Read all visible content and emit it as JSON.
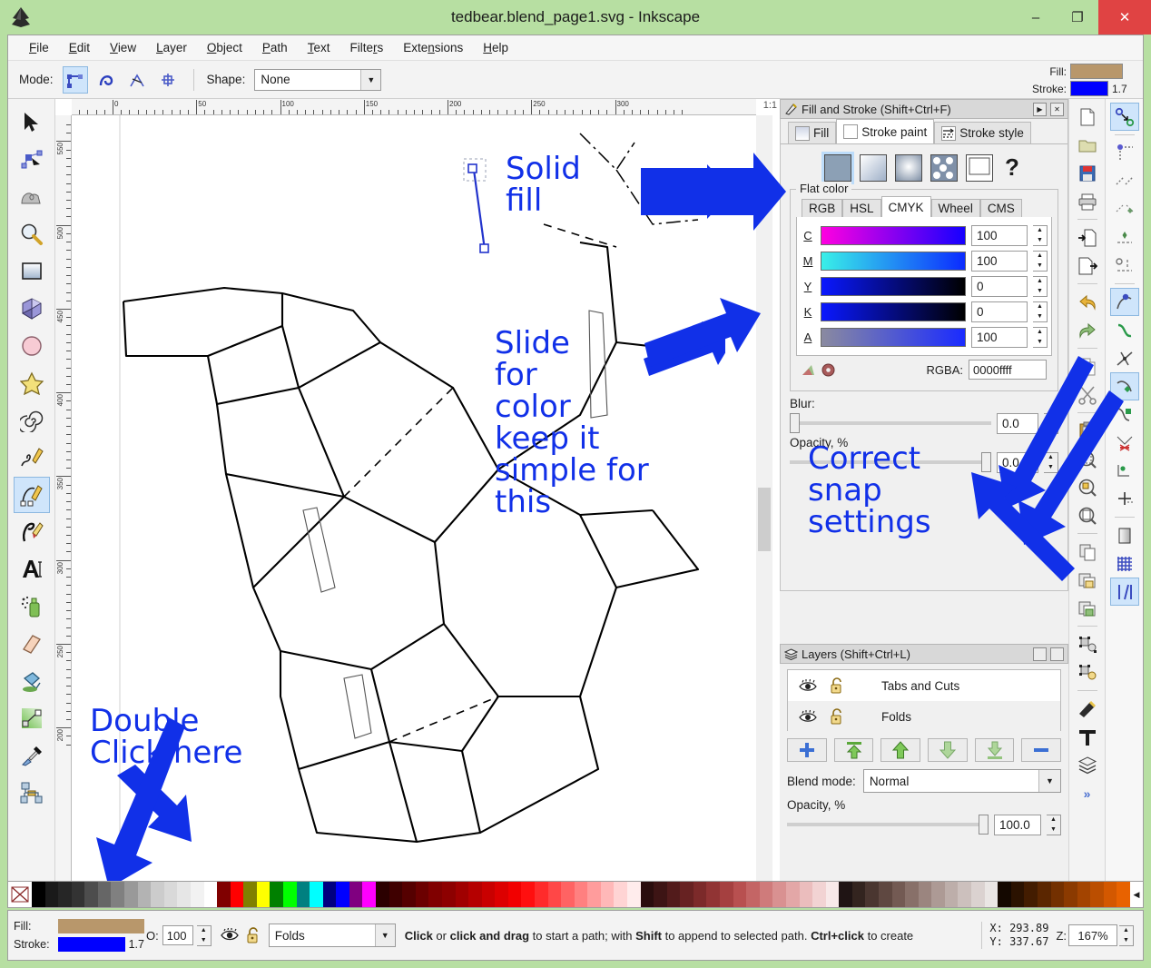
{
  "window": {
    "title": "tedbear.blend_page1.svg - Inkscape",
    "logo_icon": "inkscape-logo-icon",
    "minimize_label": "–",
    "maximize_label": "❐",
    "close_label": "✕"
  },
  "menubar": [
    {
      "label": "File",
      "accel": "F"
    },
    {
      "label": "Edit",
      "accel": "E"
    },
    {
      "label": "View",
      "accel": "V"
    },
    {
      "label": "Layer",
      "accel": "L"
    },
    {
      "label": "Object",
      "accel": "O"
    },
    {
      "label": "Path",
      "accel": "P"
    },
    {
      "label": "Text",
      "accel": "T"
    },
    {
      "label": "Filters",
      "accel": "r"
    },
    {
      "label": "Extensions",
      "accel": "n"
    },
    {
      "label": "Help",
      "accel": "H"
    }
  ],
  "toolopts": {
    "mode_label": "Mode:",
    "mode_buttons": [
      "bezier-mode-icon",
      "spiro-mode-icon",
      "bspline-mode-icon",
      "paraxial-mode-icon"
    ],
    "shape_label": "Shape:",
    "shape_value": "None"
  },
  "fill_stroke_indicator": {
    "fill_label": "Fill:",
    "stroke_label": "Stroke:",
    "fill_color": "#b8976b",
    "stroke_color": "#0000ff",
    "stroke_width": "1.7"
  },
  "toolbox": [
    {
      "name": "selector-tool",
      "icon": "arrow-cursor-icon",
      "selected": false
    },
    {
      "name": "node-tool",
      "icon": "node-editor-icon",
      "selected": false
    },
    {
      "name": "tweak-tool",
      "icon": "tweak-icon",
      "selected": false
    },
    {
      "name": "zoom-tool",
      "icon": "magnifier-icon",
      "selected": false
    },
    {
      "name": "rectangle-tool",
      "icon": "rectangle-icon",
      "selected": false
    },
    {
      "name": "box3d-tool",
      "icon": "cube-3d-icon",
      "selected": false
    },
    {
      "name": "ellipse-tool",
      "icon": "ellipse-icon",
      "selected": false
    },
    {
      "name": "star-tool",
      "icon": "star-icon",
      "selected": false
    },
    {
      "name": "spiral-tool",
      "icon": "spiral-icon",
      "selected": false
    },
    {
      "name": "pencil-tool",
      "icon": "pencil-freehand-icon",
      "selected": false
    },
    {
      "name": "bezier-tool",
      "icon": "bezier-pen-icon",
      "selected": true
    },
    {
      "name": "calligraphy-tool",
      "icon": "calligraphy-pen-icon",
      "selected": false
    },
    {
      "name": "text-tool",
      "icon": "text-A-icon",
      "selected": false
    },
    {
      "name": "spray-tool",
      "icon": "spray-can-icon",
      "selected": false
    },
    {
      "name": "eraser-tool",
      "icon": "eraser-icon",
      "selected": false
    },
    {
      "name": "bucket-tool",
      "icon": "paint-bucket-icon",
      "selected": false
    },
    {
      "name": "gradient-tool",
      "icon": "gradient-icon",
      "selected": false
    },
    {
      "name": "dropper-tool",
      "icon": "eyedropper-icon",
      "selected": false
    },
    {
      "name": "connector-tool",
      "icon": "connector-icon",
      "selected": false
    }
  ],
  "rulers": {
    "horizontal_labels": [
      "0",
      "50",
      "100",
      "150",
      "200",
      "250",
      "300"
    ],
    "vertical_labels": [
      "550",
      "500",
      "450",
      "400",
      "350",
      "300",
      "250",
      "200"
    ],
    "unit_badge": "1:1"
  },
  "canvas_notes": [
    {
      "id": "note-solid-fill",
      "text": "Solid\nfill"
    },
    {
      "id": "note-slide-for-color",
      "text": "Slide\nfor\ncolor\nkeep it\nsimple for\nthis"
    },
    {
      "id": "note-correct-snap",
      "text": "Correct\nsnap\nsettings"
    },
    {
      "id": "note-double-click",
      "text": "Double\nClick here"
    }
  ],
  "annotation_color": "#1130e8",
  "fill_stroke_dialog": {
    "title": "Fill and Stroke (Shift+Ctrl+F)",
    "icon": "fill-stroke-icon",
    "collapse_label": "▶",
    "close_label": "✕",
    "tabs": [
      {
        "label": "Fill",
        "icon": "fill-swatch-icon",
        "active": false
      },
      {
        "label": "Stroke paint",
        "icon": "stroke-swatch-icon",
        "active": true
      },
      {
        "label": "Stroke style",
        "icon": "stroke-style-icon",
        "active": false
      }
    ],
    "paint_buttons": [
      {
        "name": "flat-color-button",
        "icon": "flat-color-icon",
        "selected": true
      },
      {
        "name": "linear-gradient-button",
        "icon": "linear-gradient-icon",
        "selected": false
      },
      {
        "name": "radial-gradient-button",
        "icon": "radial-gradient-icon",
        "selected": false
      },
      {
        "name": "pattern-button",
        "icon": "pattern-icon",
        "selected": false
      },
      {
        "name": "swatch-button",
        "icon": "swatch-icon",
        "selected": false
      },
      {
        "name": "unknown-paint-button",
        "icon": "question-mark-icon",
        "selected": false
      }
    ],
    "group_label": "Flat color",
    "color_tabs": [
      {
        "label": "RGB",
        "active": false
      },
      {
        "label": "HSL",
        "active": false
      },
      {
        "label": "CMYK",
        "active": true
      },
      {
        "label": "Wheel",
        "active": false
      },
      {
        "label": "CMS",
        "active": false
      }
    ],
    "cmyk": [
      {
        "key": "C",
        "value": "100",
        "from": "#ff00e0",
        "to": "#1500ff"
      },
      {
        "key": "M",
        "value": "100",
        "from": "#39f0e8",
        "to": "#0b2bff"
      },
      {
        "key": "Y",
        "value": "0",
        "from": "#0a18ff",
        "to": "#000000"
      },
      {
        "key": "K",
        "value": "0",
        "from": "#0a18ff",
        "to": "#000000"
      },
      {
        "key": "A",
        "value": "100",
        "from": "#8a8aa0",
        "to": "#1a2bff"
      }
    ],
    "rgba_label": "RGBA:",
    "rgba_value": "0000ffff",
    "bottom_icons": [
      "color-managed-icon",
      "out-of-gamut-icon"
    ],
    "blur_label": "Blur:",
    "blur_value": "0.0",
    "opacity_label": "Opacity, %",
    "opacity_value": "0.0"
  },
  "layers_dialog": {
    "title": "Layers (Shift+Ctrl+L)",
    "icon": "layers-icon",
    "rows": [
      {
        "name": "Tabs and Cuts",
        "visible_icon": "eye-icon",
        "lock_icon": "unlock-icon"
      },
      {
        "name": "Folds",
        "visible_icon": "eye-icon",
        "lock_icon": "unlock-icon"
      }
    ],
    "buttons": [
      {
        "name": "add-layer-button",
        "icon": "plus-icon"
      },
      {
        "name": "raise-to-top-button",
        "icon": "arrow-to-top-icon"
      },
      {
        "name": "raise-layer-button",
        "icon": "arrow-up-icon"
      },
      {
        "name": "lower-layer-button",
        "icon": "arrow-down-icon"
      },
      {
        "name": "lower-to-bottom-button",
        "icon": "arrow-to-bottom-icon"
      },
      {
        "name": "delete-layer-button",
        "icon": "minus-icon"
      }
    ],
    "blend_label": "Blend mode:",
    "blend_value": "Normal",
    "opacity_label": "Opacity, %",
    "opacity_value": "100.0"
  },
  "command_bar": [
    {
      "name": "new-document-button",
      "icon": "new-document-icon"
    },
    {
      "name": "open-document-button",
      "icon": "folder-open-icon"
    },
    {
      "name": "save-document-button",
      "icon": "floppy-save-icon"
    },
    {
      "name": "print-button",
      "icon": "printer-icon"
    },
    {
      "name": "import-button",
      "icon": "import-icon"
    },
    {
      "name": "export-button",
      "icon": "export-icon"
    },
    {
      "name": "undo-button",
      "icon": "undo-arrow-icon"
    },
    {
      "name": "redo-button",
      "icon": "redo-arrow-icon"
    },
    {
      "name": "copy-button",
      "icon": "copy-icon"
    },
    {
      "name": "cut-button",
      "icon": "scissors-icon"
    },
    {
      "name": "paste-button",
      "icon": "clipboard-paste-icon"
    },
    {
      "name": "zoom-selection-button",
      "icon": "zoom-selection-icon"
    },
    {
      "name": "zoom-drawing-button",
      "icon": "zoom-drawing-icon"
    },
    {
      "name": "zoom-page-button",
      "icon": "zoom-page-icon"
    },
    {
      "name": "duplicate-button",
      "icon": "duplicate-icon"
    },
    {
      "name": "group-button",
      "icon": "group-lock-icon"
    },
    {
      "name": "ungroup-button",
      "icon": "ungroup-icon"
    },
    {
      "name": "object-to-path-button",
      "icon": "object-to-path-icon"
    },
    {
      "name": "stroke-to-path-button",
      "icon": "stroke-to-path-icon"
    },
    {
      "name": "xml-editor-button",
      "icon": "xml-editor-icon"
    },
    {
      "name": "text-and-font-button",
      "icon": "text-font-icon"
    },
    {
      "name": "layers-button",
      "icon": "layers-stack-icon"
    },
    {
      "name": "overflow-button",
      "icon": "chevron-double-right-icon"
    }
  ],
  "snap_bar": [
    {
      "name": "enable-snapping-toggle",
      "icon": "snap-master-icon",
      "on": true
    },
    {
      "name": "snap-bounding-box-toggle",
      "icon": "snap-bbox-icon",
      "on": false
    },
    {
      "name": "snap-bbox-edge-toggle",
      "icon": "snap-bbox-edge-icon",
      "on": false
    },
    {
      "name": "snap-bbox-corner-toggle",
      "icon": "snap-bbox-corner-icon",
      "on": false
    },
    {
      "name": "snap-bbox-edge-midpoint-toggle",
      "icon": "snap-edge-mid-icon",
      "on": false
    },
    {
      "name": "snap-bbox-center-toggle",
      "icon": "snap-bbox-center-icon",
      "on": false
    },
    {
      "name": "snap-nodes-paths-toggle",
      "icon": "snap-node-icon",
      "on": true
    },
    {
      "name": "snap-path-toggle",
      "icon": "snap-path-icon",
      "on": false
    },
    {
      "name": "snap-path-intersection-toggle",
      "icon": "snap-path-intersection-icon",
      "on": false
    },
    {
      "name": "snap-cusp-node-toggle",
      "icon": "snap-cusp-icon",
      "on": true
    },
    {
      "name": "snap-smooth-node-toggle",
      "icon": "snap-smooth-icon",
      "on": false
    },
    {
      "name": "snap-midpoint-toggle",
      "icon": "snap-midpoint-icon",
      "on": false
    },
    {
      "name": "snap-object-center-toggle",
      "icon": "snap-object-center-icon",
      "on": false
    },
    {
      "name": "snap-rotation-center-toggle",
      "icon": "snap-rotation-center-icon",
      "on": false
    },
    {
      "name": "snap-page-border-toggle",
      "icon": "snap-page-border-icon",
      "on": false
    },
    {
      "name": "snap-grid-toggle",
      "icon": "snap-grid-icon",
      "on": false
    },
    {
      "name": "snap-guide-toggle",
      "icon": "snap-guide-icon",
      "on": true
    }
  ],
  "palette": {
    "none_icon": "no-color-x-icon",
    "left_arrow": "◀",
    "right_arrow": "▶",
    "colors": [
      "#000000",
      "#1a1a1a",
      "#262626",
      "#333333",
      "#4d4d4d",
      "#666666",
      "#808080",
      "#999999",
      "#b3b3b3",
      "#ccccc c",
      "#d9d9d9",
      "#e6e6e6",
      "#f2f2f2",
      "#ffffff",
      "#800000",
      "#ff0000",
      "#808000",
      "#ffff00",
      "#008000",
      "#00ff00",
      "#008080",
      "#00ffff",
      "#000080",
      "#0000ff",
      "#800080",
      "#ff00ff",
      "#2b0000",
      "#3f0000",
      "#550000",
      "#6b0000",
      "#800000",
      "#8d0000",
      "#a00000",
      "#b50000",
      "#c90000",
      "#dd0000",
      "#f20000",
      "#ff0f0f",
      "#ff2b2b",
      "#ff4747",
      "#ff6363",
      "#ff8080",
      "#ff9c9c",
      "#ffb8b8",
      "#ffd4d4",
      "#ffecec",
      "#2a0d0d",
      "#3d1414",
      "#521b1b",
      "#672222",
      "#7c2a2a",
      "#913434",
      "#a54040",
      "#b85050",
      "#c46565",
      "#cf7b7b",
      "#d99191",
      "#e3a7a7",
      "#ebbdbd",
      "#f2d3d3",
      "#f8e9e9",
      "#1f1414",
      "#33241f",
      "#4a3630",
      "#5f4841",
      "#735a53",
      "#887069",
      "#9b857f",
      "#ad9a95",
      "#bdaeaa",
      "#ccc0bd",
      "#dbd2d0",
      "#eae6e4",
      "#140800",
      "#2b1200",
      "#431c00",
      "#5b2600",
      "#733000",
      "#8b3a00",
      "#a34400",
      "#bb4e00",
      "#d35800",
      "#e86200"
    ]
  },
  "statusbar": {
    "fill_label": "Fill:",
    "stroke_label": "Stroke:",
    "fill_color": "#b8976b",
    "stroke_color": "#0000ff",
    "stroke_width": "1.7",
    "opacity_label": "O:",
    "opacity_value": "100",
    "eye_icon": "eye-icon",
    "lock_icon": "unlock-icon",
    "layer_value": "Folds",
    "message": "Click or click and drag to start a path; with Shift to append to selected path. Ctrl+click to create",
    "message_parts": [
      {
        "t": "Click",
        "b": true
      },
      {
        "t": " or ",
        "b": false
      },
      {
        "t": "click and drag",
        "b": true
      },
      {
        "t": " to start a path; with ",
        "b": false
      },
      {
        "t": "Shift",
        "b": true
      },
      {
        "t": " to append to selected path. ",
        "b": false
      },
      {
        "t": "Ctrl+click",
        "b": true
      },
      {
        "t": " to create",
        "b": false
      }
    ],
    "x_label": "X:",
    "x_value": "293.89",
    "y_label": "Y:",
    "y_value": "337.67",
    "zoom_label": "Z:",
    "zoom_value": "167%"
  }
}
